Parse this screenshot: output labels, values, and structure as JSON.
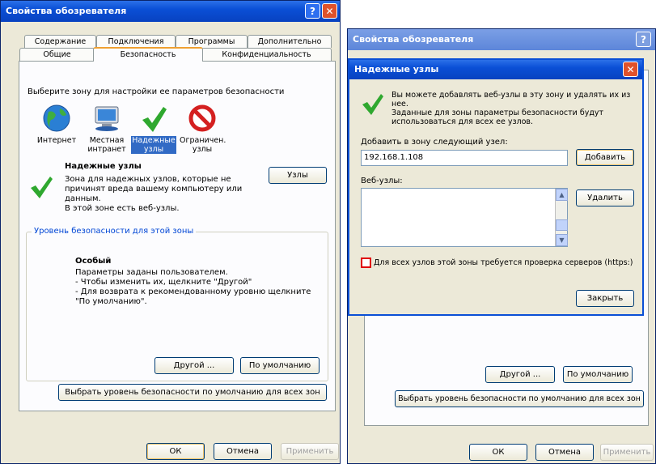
{
  "left_dialog": {
    "title": "Свойства обозревателя",
    "tabs_row1": [
      "Содержание",
      "Подключения",
      "Программы",
      "Дополнительно"
    ],
    "tabs_row2": [
      "Общие",
      "Безопасность",
      "Конфиденциальность"
    ],
    "zone_prompt": "Выберите зону для настройки ее параметров безопасности",
    "zones": [
      {
        "label": "Интернет",
        "icon": "globe-icon"
      },
      {
        "label": "Местная\nинтранет",
        "icon": "intranet-icon"
      },
      {
        "label": "Надежные\nузлы",
        "icon": "trusted-check-icon"
      },
      {
        "label": "Ограничен.\nузлы",
        "icon": "restricted-icon"
      }
    ],
    "zone_title": "Надежные узлы",
    "zone_description": "Зона для надежных узлов, которые не\nпричинят вреда вашему компьютеру или\nданным.\nВ этой зоне есть веб-узлы.",
    "sites_button": "Узлы",
    "level_group_title": "Уровень безопасности для этой зоны",
    "level_name": "Особый",
    "level_text": "Параметры заданы пользователем.\n- Чтобы изменить их, щелкните \"Другой\"\n- Для возврата к рекомендованному уровню щелкните\n\"По умолчанию\".",
    "custom_button": "Другой ...",
    "default_button": "По умолчанию",
    "reset_all_button": "Выбрать уровень безопасности по умолчанию для всех зон",
    "ok": "ОК",
    "cancel": "Отмена",
    "apply": "Применить"
  },
  "right_dialog": {
    "title": "Свойства обозревателя",
    "custom_button": "Другой ...",
    "default_button": "По умолчанию",
    "reset_all_button": "Выбрать уровень безопасности по умолчанию для всех зон",
    "ok": "ОК",
    "cancel": "Отмена",
    "apply": "Применить"
  },
  "trusted_dialog": {
    "title": "Надежные узлы",
    "info": "Вы можете добавлять веб-узлы в эту зону и удалять их из нее.\nЗаданные для зоны параметры безопасности будут\nиспользоваться для всех ее узлов.",
    "add_label": "Добавить в зону следующий узел:",
    "add_value": "192.168.1.108",
    "add_button": "Добавить",
    "sites_label": "Веб-узлы:",
    "remove_button": "Удалить",
    "https_checkbox": "Для всех узлов этой зоны требуется проверка серверов (https:)",
    "https_checked": false,
    "close_button": "Закрыть"
  }
}
